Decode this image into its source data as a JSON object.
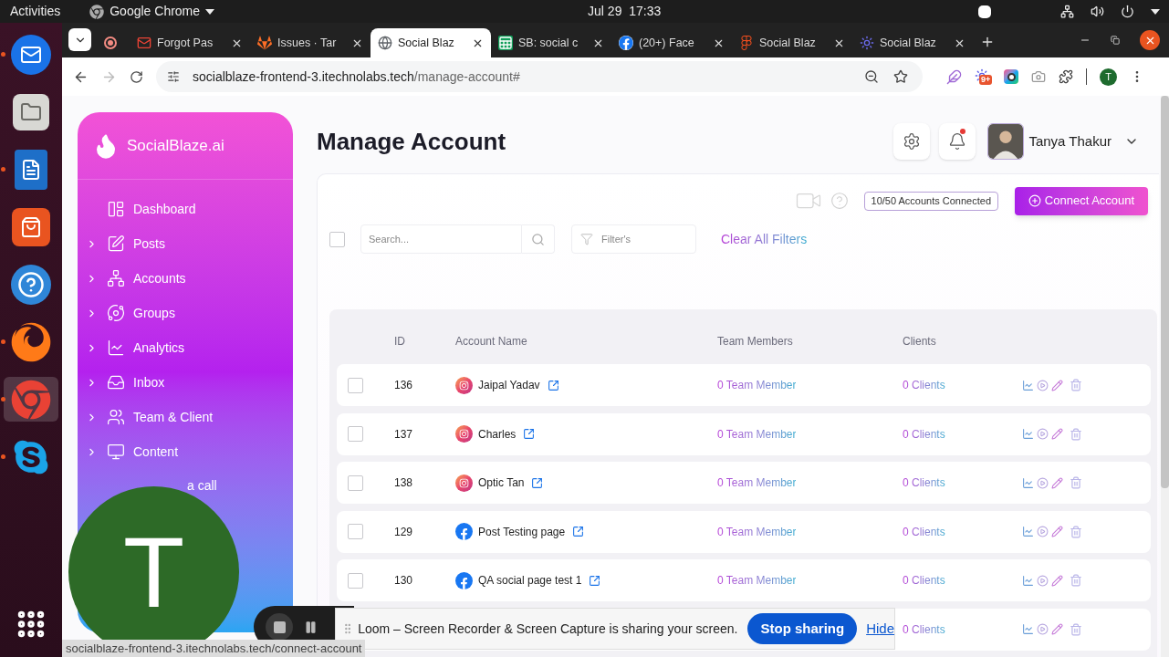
{
  "system_bar": {
    "activities": "Activities",
    "app_menu": "Google Chrome",
    "clock": "Jul 29  17:33"
  },
  "dock": [
    {
      "kind": "thunderbird",
      "running": true,
      "selected": false
    },
    {
      "kind": "files",
      "running": false,
      "selected": false
    },
    {
      "kind": "writer",
      "running": true,
      "selected": false
    },
    {
      "kind": "appcenter",
      "running": false,
      "selected": false
    },
    {
      "kind": "help",
      "running": false,
      "selected": false
    },
    {
      "kind": "firefox",
      "running": true,
      "selected": false
    },
    {
      "kind": "chrome",
      "running": true,
      "selected": true
    },
    {
      "kind": "skype",
      "running": true,
      "selected": false
    },
    {
      "kind": "apps",
      "running": false,
      "selected": false
    }
  ],
  "browser": {
    "tabs": [
      {
        "kind": "record",
        "selected": false
      },
      {
        "kind": "gmail",
        "title": "Forgot Pas",
        "selected": false
      },
      {
        "kind": "gitlab",
        "title": "Issues · Tar",
        "selected": false
      },
      {
        "kind": "globe",
        "title": "Social Blaz",
        "selected": true
      },
      {
        "kind": "sheets",
        "title": "SB: social c",
        "selected": false
      },
      {
        "kind": "facebook",
        "title": "(20+) Face",
        "selected": false
      },
      {
        "kind": "figma",
        "title": "Social Blaz",
        "selected": false
      },
      {
        "kind": "sun",
        "title": "Social Blaz",
        "selected": false
      }
    ],
    "address": {
      "host": "socialblaze-frontend-3.itechnolabs.tech",
      "path": "/manage-account#"
    },
    "extension_badge": "9+",
    "profile_initial": "T"
  },
  "sidebar": {
    "brand": "SocialBlaze.ai",
    "items": [
      {
        "label": "Dashboard",
        "kind": "dashboard",
        "expandable": false
      },
      {
        "label": "Posts",
        "kind": "posts",
        "expandable": true
      },
      {
        "label": "Accounts",
        "kind": "accounts",
        "expandable": true
      },
      {
        "label": "Groups",
        "kind": "groups",
        "expandable": true
      },
      {
        "label": "Analytics",
        "kind": "analytics",
        "expandable": true
      },
      {
        "label": "Inbox",
        "kind": "inbox",
        "expandable": true
      },
      {
        "label": "Team & Client",
        "kind": "team",
        "expandable": true
      },
      {
        "label": "Content",
        "kind": "content",
        "expandable": true
      },
      {
        "label": "a call",
        "kind": "call"
      }
    ]
  },
  "header": {
    "title": "Manage Account",
    "user_name": "Tanya Thakur",
    "notification_unread": true
  },
  "toolbar": {
    "accounts_badge": "10/50 Accounts Connected",
    "connect_button": "Connect Account"
  },
  "filters": {
    "select_all_checked": false,
    "search": {
      "placeholder": "Search..."
    },
    "filter": {
      "placeholder": "Filter's"
    },
    "clear_button": "Clear All Filters"
  },
  "table": {
    "columns": [
      "ID",
      "Account Name",
      "Team Members",
      "Clients"
    ],
    "rows": [
      {
        "checked": false,
        "id": "136",
        "kind": "instagram",
        "name": "Jaipal Yadav",
        "team": "0 Team Member",
        "clients": "0 Clients"
      },
      {
        "checked": false,
        "id": "137",
        "kind": "instagram",
        "name": "Charles",
        "team": "0 Team Member",
        "clients": "0 Clients"
      },
      {
        "checked": false,
        "id": "138",
        "kind": "instagram",
        "name": "Optic Tan",
        "team": "0 Team Member",
        "clients": "0 Clients"
      },
      {
        "checked": false,
        "id": "129",
        "kind": "facebook",
        "name": "Post Testing page",
        "team": "0 Team Member",
        "clients": "0 Clients"
      },
      {
        "checked": false,
        "id": "130",
        "kind": "facebook",
        "name": "QA social page test 1",
        "team": "0 Team Member",
        "clients": "0 Clients"
      },
      {
        "clients": "0 Clients"
      }
    ]
  },
  "screen_share": {
    "message": "Loom – Screen Recorder & Screen Capture is sharing your screen.",
    "stop_button": "Stop sharing",
    "hide_link": "Hide"
  },
  "camera_bubble": {
    "initial": "T"
  },
  "status_url": "socialblaze-frontend-3.itechnolabs.tech/connect-account"
}
